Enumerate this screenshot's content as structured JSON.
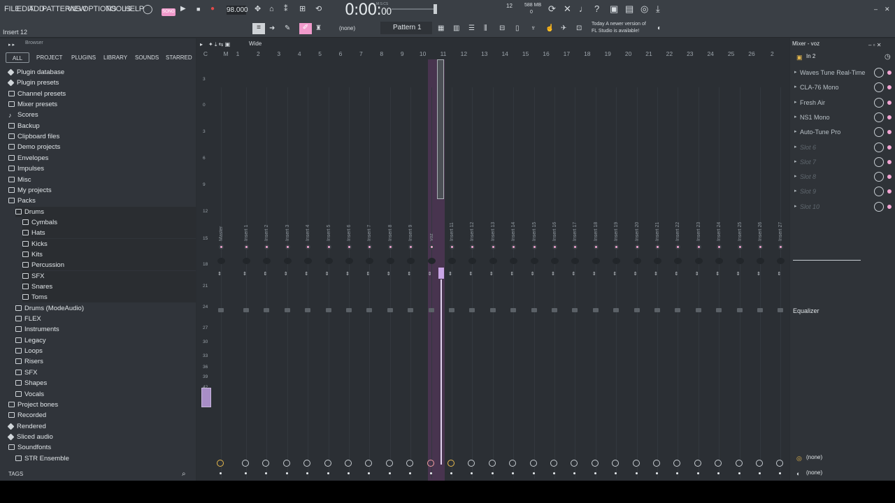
{
  "menu": [
    "FILE",
    "EDIT",
    "ADD",
    "PATTERNS",
    "VIEW",
    "OPTIONS",
    "TOOLS",
    "HELP"
  ],
  "hint": "Insert 12",
  "song_mode": "SONG",
  "tempo": "98.000",
  "time": {
    "main": "0:00:",
    "sub": "00",
    "label": "M:S:CS"
  },
  "voices": "12",
  "cpu": {
    "ram": "588 MB",
    "count": "0"
  },
  "pattern": "Pattern 1",
  "snap": "(none)",
  "news": {
    "line1": "Today  A newer version of",
    "line2": "FL Studio is available!"
  },
  "browser": {
    "title": "Browser",
    "tabs": [
      "ALL",
      "PROJECT",
      "PLUGINS",
      "LIBRARY",
      "SOUNDS",
      "STARRED"
    ],
    "items": [
      {
        "label": "Plugin database",
        "indent": 0,
        "type": "plug"
      },
      {
        "label": "Plugin presets",
        "indent": 0,
        "type": "plug"
      },
      {
        "label": "Channel presets",
        "indent": 0,
        "type": "folder"
      },
      {
        "label": "Mixer presets",
        "indent": 0,
        "type": "folder"
      },
      {
        "label": "Scores",
        "indent": 0,
        "type": "note"
      },
      {
        "label": "Backup",
        "indent": 0,
        "type": "folder"
      },
      {
        "label": "Clipboard files",
        "indent": 0,
        "type": "folder"
      },
      {
        "label": "Demo projects",
        "indent": 0,
        "type": "folder"
      },
      {
        "label": "Envelopes",
        "indent": 0,
        "type": "folder"
      },
      {
        "label": "Impulses",
        "indent": 0,
        "type": "folder"
      },
      {
        "label": "Misc",
        "indent": 0,
        "type": "folder"
      },
      {
        "label": "My projects",
        "indent": 0,
        "type": "folder"
      },
      {
        "label": "Packs",
        "indent": 0,
        "type": "folder"
      },
      {
        "label": "Drums",
        "indent": 1,
        "type": "folder"
      },
      {
        "label": "Cymbals",
        "indent": 2,
        "type": "folder"
      },
      {
        "label": "Hats",
        "indent": 2,
        "type": "folder"
      },
      {
        "label": "Kicks",
        "indent": 2,
        "type": "folder"
      },
      {
        "label": "Kits",
        "indent": 2,
        "type": "folder"
      },
      {
        "label": "Percussion",
        "indent": 2,
        "type": "folder"
      },
      {
        "label": "SFX",
        "indent": 2,
        "type": "folder"
      },
      {
        "label": "Snares",
        "indent": 2,
        "type": "folder"
      },
      {
        "label": "Toms",
        "indent": 2,
        "type": "folder"
      },
      {
        "label": "Drums (ModeAudio)",
        "indent": 1,
        "type": "folder"
      },
      {
        "label": "FLEX",
        "indent": 1,
        "type": "folder"
      },
      {
        "label": "Instruments",
        "indent": 1,
        "type": "folder"
      },
      {
        "label": "Legacy",
        "indent": 1,
        "type": "folder"
      },
      {
        "label": "Loops",
        "indent": 1,
        "type": "folder"
      },
      {
        "label": "Risers",
        "indent": 1,
        "type": "folder"
      },
      {
        "label": "SFX",
        "indent": 1,
        "type": "folder"
      },
      {
        "label": "Shapes",
        "indent": 1,
        "type": "folder"
      },
      {
        "label": "Vocals",
        "indent": 1,
        "type": "folder"
      },
      {
        "label": "Project bones",
        "indent": 0,
        "type": "folder"
      },
      {
        "label": "Recorded",
        "indent": 0,
        "type": "folder"
      },
      {
        "label": "Rendered",
        "indent": 0,
        "type": "plug"
      },
      {
        "label": "Sliced audio",
        "indent": 0,
        "type": "plug"
      },
      {
        "label": "Soundfonts",
        "indent": 0,
        "type": "folder"
      },
      {
        "label": "STR Ensemble",
        "indent": 1,
        "type": "folder"
      }
    ],
    "tags": "TAGS"
  },
  "mixer": {
    "mode": "Wide",
    "scale": [
      "3",
      "0",
      "3",
      "6",
      "9",
      "12",
      "15",
      "18",
      "21",
      "24",
      "27",
      "30",
      "33",
      "36",
      "39",
      "42"
    ],
    "tracks": [
      "Master",
      "Insert 1",
      "Insert 2",
      "Insert 3",
      "Insert 4",
      "Insert 5",
      "Insert 6",
      "Insert 7",
      "Insert 8",
      "Insert 9",
      "voz",
      "Insert 11",
      "Insert 12",
      "Insert 13",
      "Insert 14",
      "Insert 15",
      "Insert 16",
      "Insert 17",
      "Insert 18",
      "Insert 19",
      "Insert 20",
      "Insert 21",
      "Insert 22",
      "Insert 23",
      "Insert 24",
      "Insert 25",
      "Insert 26",
      "Insert 27"
    ],
    "numbers": [
      "C",
      "M",
      "1",
      "2",
      "3",
      "4",
      "5",
      "6",
      "7",
      "8",
      "9",
      "10",
      "11",
      "12",
      "13",
      "14",
      "15",
      "16",
      "17",
      "18",
      "19",
      "20",
      "21",
      "22",
      "23",
      "24",
      "25",
      "26",
      "2"
    ],
    "selected_index": 10
  },
  "rpanel": {
    "title": "Mixer - voz",
    "input": "In 2",
    "slots": [
      {
        "name": "Waves Tune Real-Time",
        "active": true
      },
      {
        "name": "CLA-76 Mono",
        "active": true
      },
      {
        "name": "Fresh Air",
        "active": true
      },
      {
        "name": "NS1 Mono",
        "active": true
      },
      {
        "name": "Auto-Tune Pro",
        "active": true
      },
      {
        "name": "Slot 6",
        "active": false
      },
      {
        "name": "Slot 7",
        "active": false
      },
      {
        "name": "Slot 8",
        "active": false
      },
      {
        "name": "Slot 9",
        "active": false
      },
      {
        "name": "Slot 10",
        "active": false
      }
    ],
    "equalizer": "Equalizer",
    "out1": "(none)",
    "out2": "(none)"
  }
}
